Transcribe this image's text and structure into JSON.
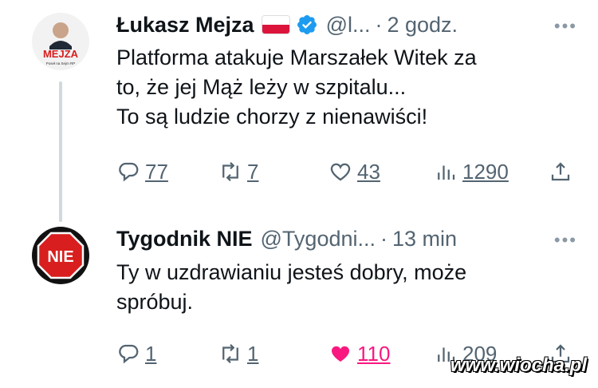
{
  "tweets": [
    {
      "author": {
        "name": "Łukasz Mejza",
        "handle": "@l...",
        "time": "2 godz.",
        "avatar_text": "MEJZA",
        "avatar_subtext": "Poseł na Sejm RP"
      },
      "text_lines": [
        "Platforma atakuje Marszałek Witek za",
        "to, że jej Mąż leży w szpitalu...",
        "To są ludzie chorzy z nienawiści!"
      ],
      "actions": {
        "replies": "77",
        "retweets": "7",
        "likes": "43",
        "views": "1290"
      }
    },
    {
      "author": {
        "name": "Tygodnik NIE",
        "handle": "@Tygodni...",
        "time": "13 min",
        "avatar_text": "NIE"
      },
      "text_lines": [
        "Ty w uzdrawianiu jesteś dobry, może",
        "spróbuj."
      ],
      "actions": {
        "replies": "1",
        "retweets": "1",
        "likes": "110",
        "views": "209"
      }
    }
  ],
  "separator": "·",
  "watermark": "www.wiocha.pl",
  "colors": {
    "like_active": "#f91880",
    "secondary_text": "#536471",
    "verified": "#1d9bf0",
    "nie_red": "#d81e1e"
  }
}
